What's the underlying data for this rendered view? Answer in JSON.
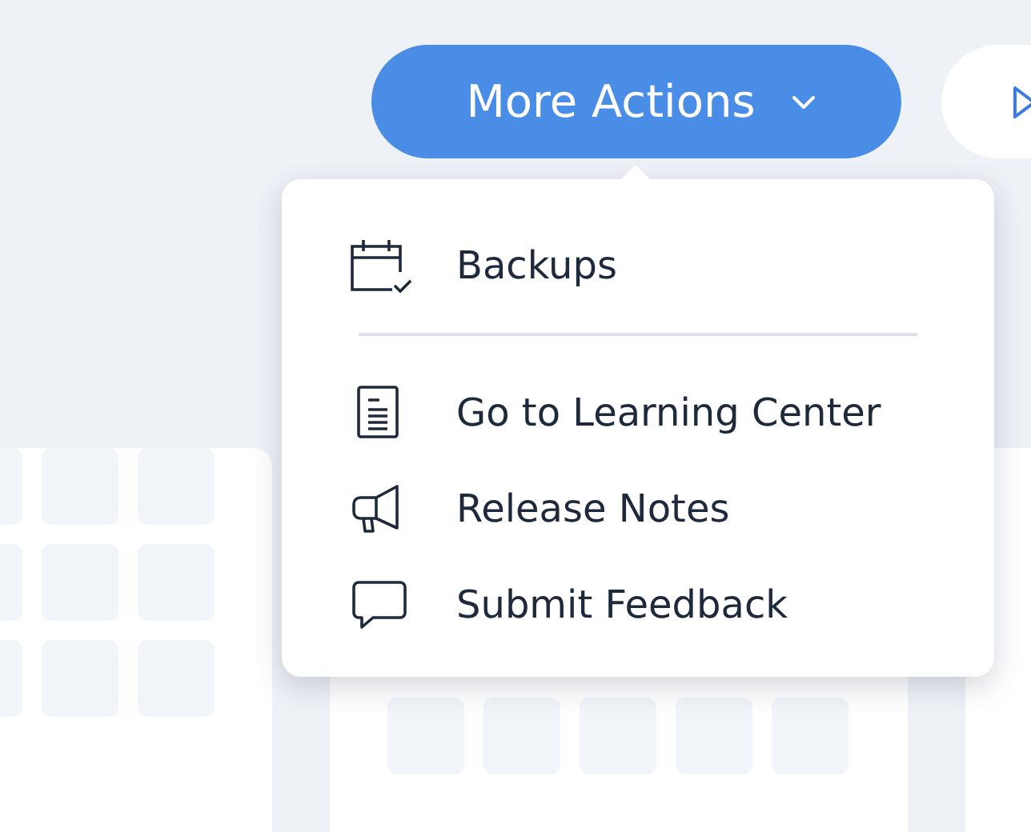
{
  "button": {
    "label": "More Actions"
  },
  "menu": {
    "sections": [
      [
        {
          "label": "Backups"
        }
      ],
      [
        {
          "label": "Go to Learning Center"
        },
        {
          "label": "Release Notes"
        },
        {
          "label": "Submit Feedback"
        }
      ]
    ]
  }
}
